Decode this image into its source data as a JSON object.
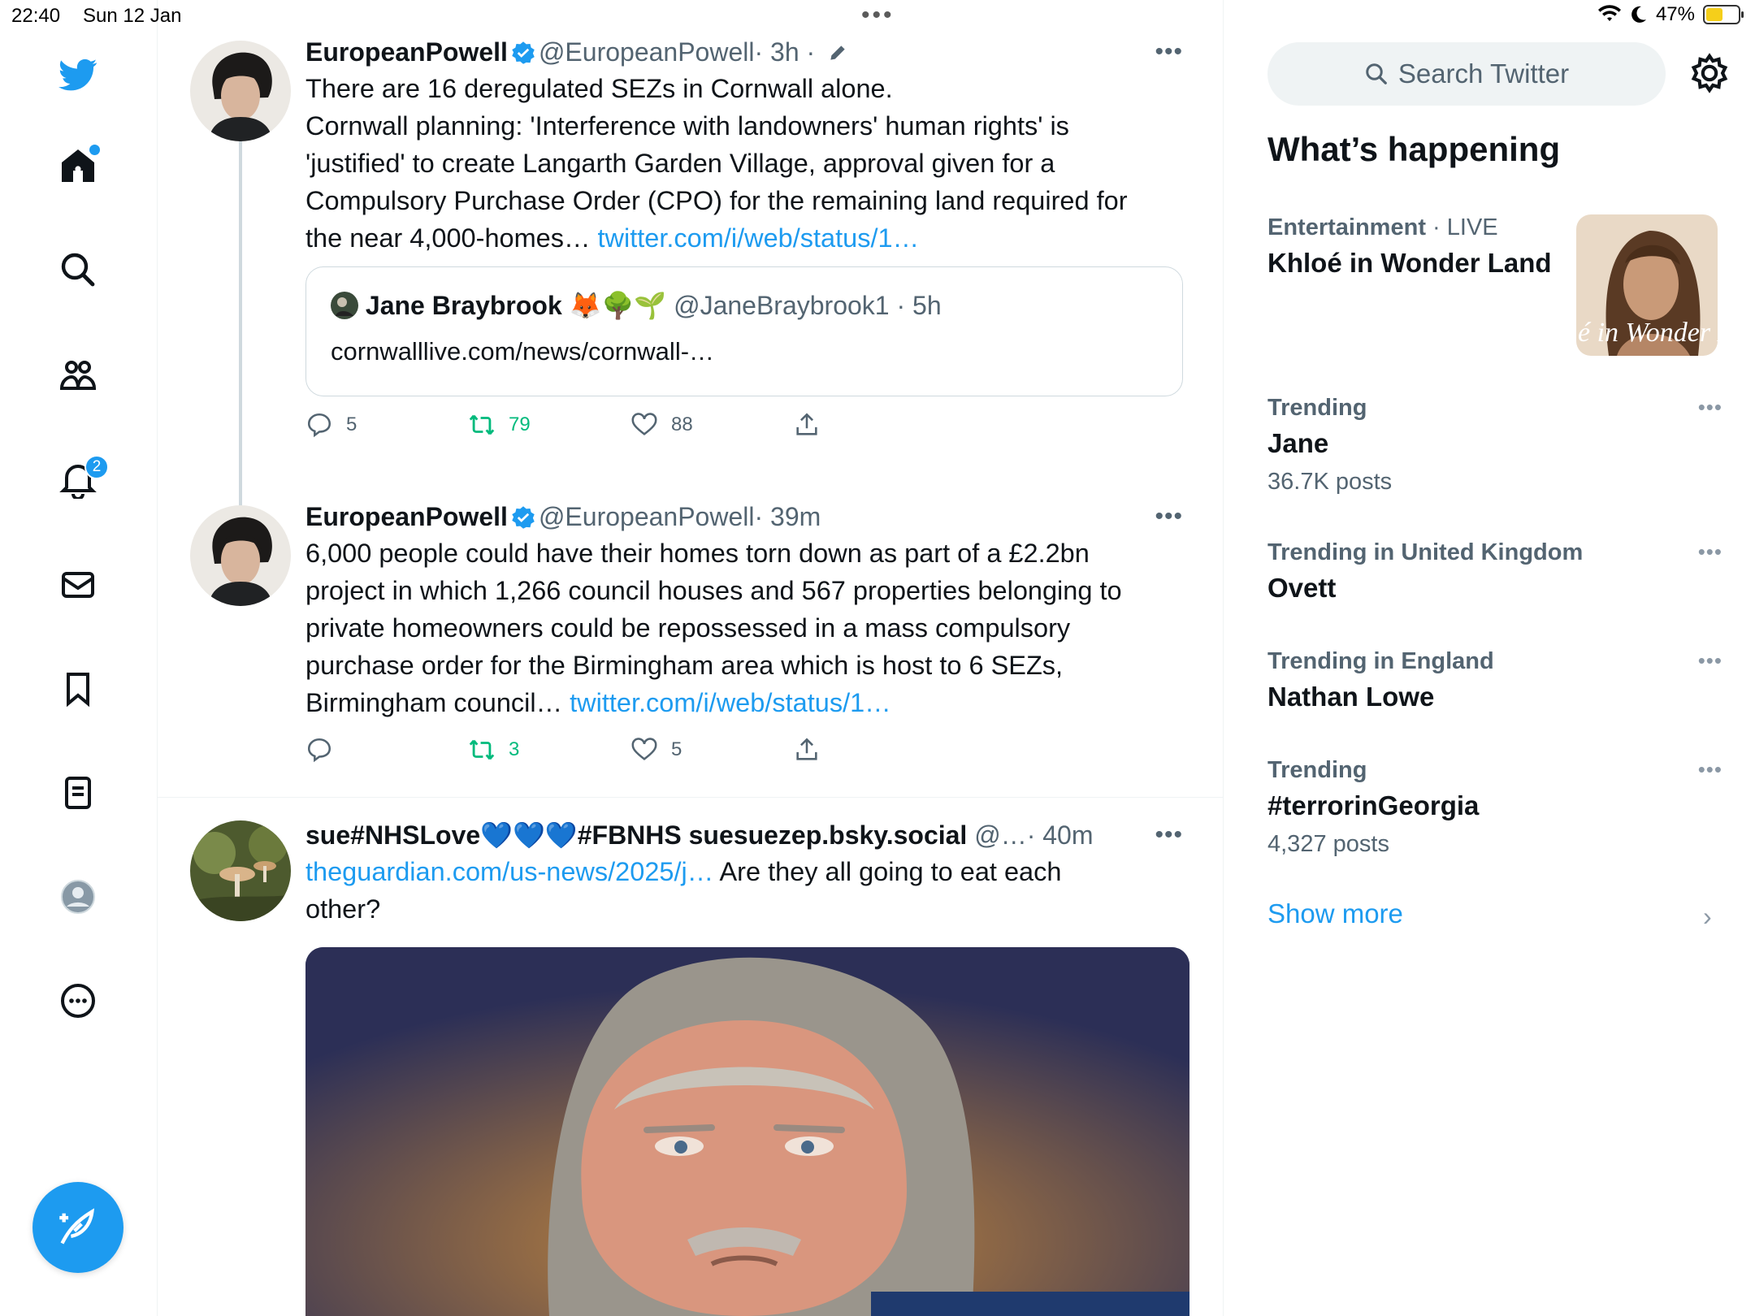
{
  "status_bar": {
    "time": "22:40",
    "date": "Sun 12 Jan",
    "battery": "47%",
    "battery_level": 0.47
  },
  "nav": {
    "notifications_count": "2",
    "icons": [
      "twitter-logo-icon",
      "home-icon",
      "search-icon",
      "communities-icon",
      "bell-icon",
      "mail-icon",
      "bookmark-icon",
      "lists-icon",
      "profile-icon",
      "more-icon",
      "compose-icon"
    ]
  },
  "tweets": [
    {
      "name": "EuropeanPowell",
      "handle": "@EuropeanPowell",
      "time": "· 3h ·",
      "text": "There are 16 deregulated SEZs in Cornwall alone.\nCornwall planning: 'Interference with landowners' human rights' is\n'justified' to create Langarth Garden Village, approval given for a\nCompulsory Purchase Order (CPO) for the remaining land required for\nthe near 4,000-homes… ",
      "link": "twitter.com/i/web/status/1…",
      "quote": {
        "name": "Jane Braybrook",
        "emojis": "🦊🌳🌱",
        "handle": "@JaneBraybrook1 · 5h",
        "text": "cornwalllive.com/news/cornwall-…"
      },
      "replies": "5",
      "retweets": "79",
      "likes": "88"
    },
    {
      "name": "EuropeanPowell",
      "handle": "@EuropeanPowell",
      "time": "· 39m",
      "text": "6,000 people could have their homes torn down as part of a £2.2bn\nproject in which 1,266 council houses and 567 properties belonging to\nprivate homeowners could be repossessed in a mass compulsory\npurchase order for the Birmingham area which is host to 6 SEZs,\nBirmingham council… ",
      "link": "twitter.com/i/web/status/1…",
      "replies": "",
      "retweets": "3",
      "likes": "5"
    },
    {
      "name": "sue#NHSLove💙💙💙#FBNHS suesuezep.bsky.social",
      "handle": "@…",
      "time": "· 40m",
      "link": "theguardian.com/us-news/2025/j…",
      "text": " Are they all going to eat each\nother?"
    }
  ],
  "sidebar": {
    "search_placeholder": "Search Twitter",
    "title": "What’s happening",
    "featured": {
      "category": "Entertainment",
      "status": "· LIVE",
      "topic": "Khloé in Wonder Land",
      "image_caption": "é in Wonder L"
    },
    "trends": [
      {
        "context": "Trending",
        "topic": "Jane",
        "count": "36.7K posts"
      },
      {
        "context": "Trending in United Kingdom",
        "topic": "Ovett",
        "count": ""
      },
      {
        "context": "Trending in England",
        "topic": "Nathan Lowe",
        "count": ""
      },
      {
        "context": "Trending",
        "topic": "#terrorinGeorgia",
        "count": "4,327 posts"
      }
    ],
    "show_more": "Show more"
  },
  "colors": {
    "accent": "#1d9bf0",
    "retweet": "#00ba7c",
    "secondary_text": "#536471"
  }
}
